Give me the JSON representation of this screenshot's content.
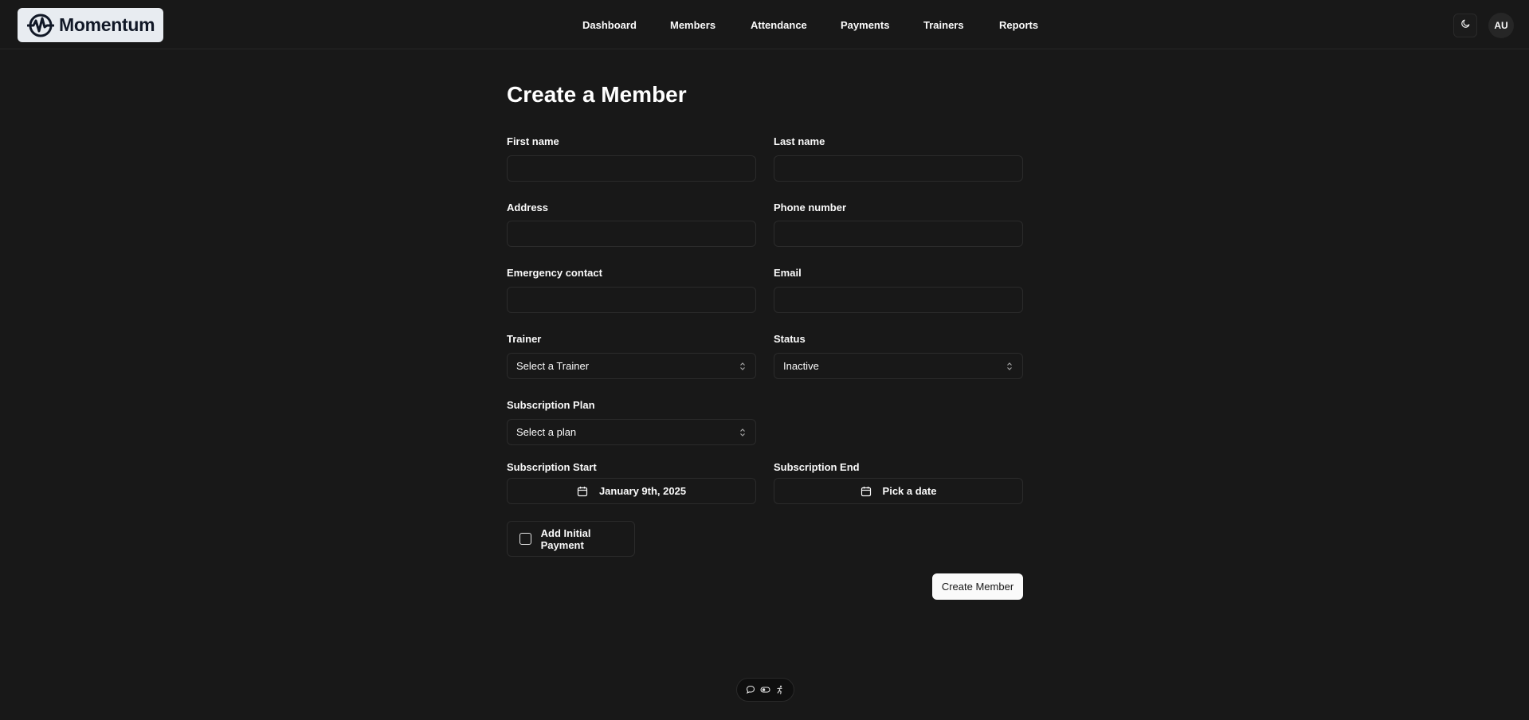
{
  "brand": {
    "name": "Momentum"
  },
  "nav": {
    "items": [
      {
        "label": "Dashboard"
      },
      {
        "label": "Members"
      },
      {
        "label": "Attendance"
      },
      {
        "label": "Payments"
      },
      {
        "label": "Trainers"
      },
      {
        "label": "Reports"
      }
    ]
  },
  "header": {
    "theme_icon": "moon-icon",
    "avatar_initials": "AU"
  },
  "form": {
    "title": "Create a Member",
    "first_name": {
      "label": "First name",
      "value": ""
    },
    "last_name": {
      "label": "Last name",
      "value": ""
    },
    "address": {
      "label": "Address",
      "value": ""
    },
    "phone": {
      "label": "Phone number",
      "value": ""
    },
    "emergency_contact": {
      "label": "Emergency contact",
      "value": ""
    },
    "email": {
      "label": "Email",
      "value": ""
    },
    "trainer": {
      "label": "Trainer",
      "value": "Select a Trainer"
    },
    "status": {
      "label": "Status",
      "value": "Inactive"
    },
    "plan": {
      "label": "Subscription Plan",
      "value": "Select a plan"
    },
    "sub_start": {
      "label": "Subscription Start",
      "value": "January 9th, 2025"
    },
    "sub_end": {
      "label": "Subscription End",
      "value": "Pick a date"
    },
    "initial_payment": {
      "label": "Add Initial Payment",
      "checked": false
    },
    "submit_label": "Create Member"
  },
  "colors": {
    "background": "#181818",
    "text": "#fafafa",
    "border": "#2b2b2b",
    "logo_bg": "#e8ecf1"
  },
  "dev_toolbar": {
    "icons": [
      "chat-icon",
      "toggle-icon",
      "accessibility-icon"
    ]
  }
}
